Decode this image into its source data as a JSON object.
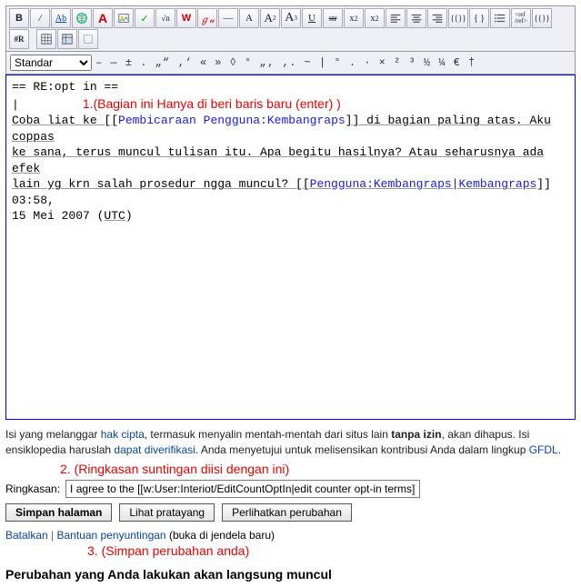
{
  "toolbar": {
    "buttons": [
      "B",
      "/",
      "Ab",
      "🌐",
      "A",
      "≡",
      "✓",
      "√n",
      "W",
      "𝒢𝓊",
      "—",
      "A",
      "A²",
      "A³",
      "U",
      "str",
      "x²",
      "x²",
      "≡",
      "≡",
      "≡",
      "{{}}",
      "{}",
      "≡",
      "<ref>",
      "{{}}",
      "#R",
      "▦",
      "▦",
      "⬚"
    ],
    "dropdown_label": "Standar",
    "special_chars": "– — ± . „“ ‚‘ « » ◊ ° „‚ ‚. ~ | ° . · × ² ³ ½ ¼ € †"
  },
  "editor": {
    "line1": "== RE:opt in ==",
    "annotation1": "1.(Bagian ini Hanya di beri baris baru (enter) )",
    "body_parts": {
      "p1": "Coba liat ke [[",
      "link1": "Pembicaraan Pengguna:Kembangraps",
      "p2": "]] di bagian paling atas. Aku coppas",
      "p3": "ke sana, terus muncul tulisan itu. Apa begitu hasilnya? Atau seharusnya ada efek",
      "p4": "lain yg krn salah prosedur ngga muncul? [[",
      "link2": "Pengguna:Kembangraps|Kembangraps",
      "p5": "]] 03:58,",
      "p6": "15 Mei 2007 (",
      "link3": "UTC",
      "p7": ")"
    }
  },
  "notice": {
    "t1": "Isi yang melanggar ",
    "link_copy": "hak cipta",
    "t2": ", termasuk menyalin mentah-mentah dari situs lain ",
    "bold1": "tanpa izin",
    "t3": ", akan dihapus. Isi ensiklopedia haruslah ",
    "link_verify": "dapat diverifikasi",
    "t4": ". Anda menyetujui untuk melisensikan kontribusi Anda dalam lingkup ",
    "link_gfdl": "GFDL",
    "t5": "."
  },
  "annotation2": "2. (Ringkasan suntingan diisi dengan ini)",
  "summary": {
    "label": "Ringkasan:",
    "value": "I agree to the [[w:User:Interiot/EditCountOptIn|edit counter opt-in terms]]"
  },
  "buttons": {
    "save": "Simpan halaman",
    "preview": "Lihat pratayang",
    "changes": "Perlihatkan perubahan",
    "cancel": "Batalkan",
    "help": "Bantuan penyuntingan",
    "help_suffix": " (buka di jendela baru)"
  },
  "annotation3": "3. (Simpan perubahan anda)",
  "final": "Perubahan yang Anda lakukan akan langsung muncul"
}
